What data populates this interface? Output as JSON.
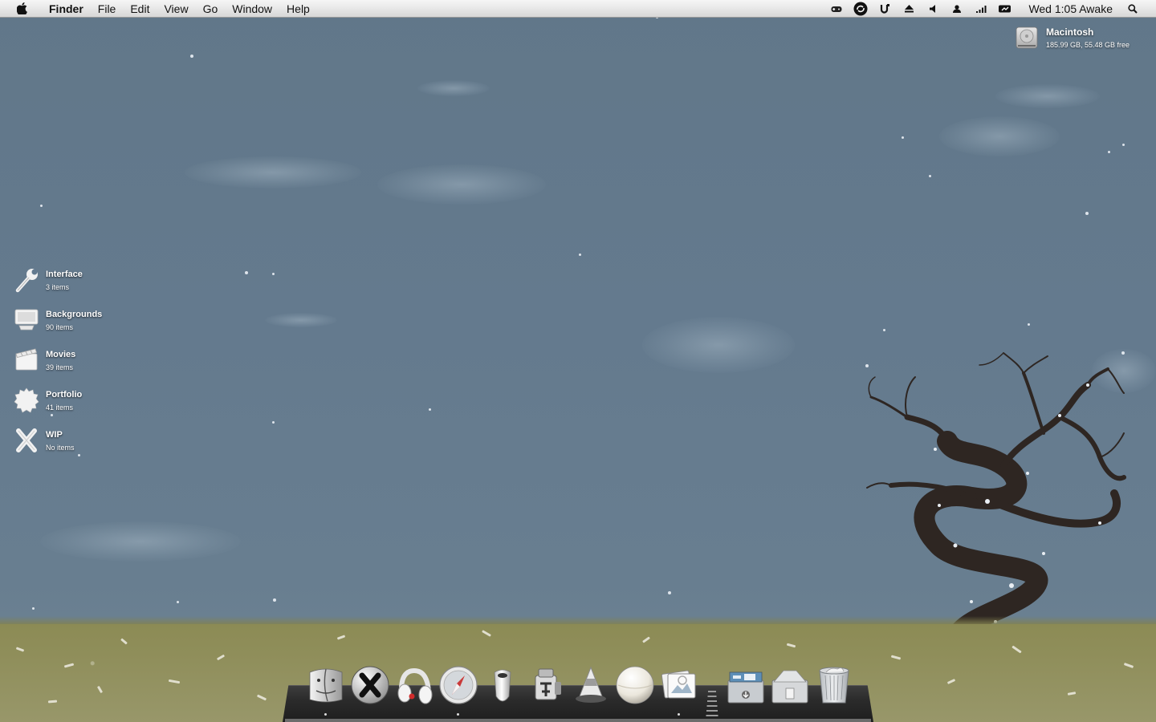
{
  "menubar": {
    "apple_icon": "apple-icon",
    "app_name": "Finder",
    "menus": [
      "File",
      "Edit",
      "View",
      "Go",
      "Window",
      "Help"
    ],
    "status_icons": [
      "gamepad-icon",
      "sync-icon",
      "u-icon",
      "eject-icon",
      "volume-icon",
      "user-icon",
      "wifi-icon",
      "battery-icon"
    ],
    "clock": "Wed 1:05 Awake",
    "search_icon": "spotlight-icon"
  },
  "volume": {
    "name": "Macintosh",
    "info": "185.99 GB, 55.48 GB free"
  },
  "desktop_folders": [
    {
      "name": "Interface",
      "count": "3 items",
      "icon": "wrench-icon"
    },
    {
      "name": "Backgrounds",
      "count": "90 items",
      "icon": "monitor-icon"
    },
    {
      "name": "Movies",
      "count": "39 items",
      "icon": "clapperboard-icon"
    },
    {
      "name": "Portfolio",
      "count": "41 items",
      "icon": "badge-icon"
    },
    {
      "name": "WIP",
      "count": "No items",
      "icon": "x-icon"
    }
  ],
  "dock": {
    "items": [
      {
        "name": "finder",
        "icon": "finder-icon",
        "running": true
      },
      {
        "name": "system-x",
        "icon": "x-app-icon",
        "running": false
      },
      {
        "name": "beats-headphones",
        "icon": "headphones-icon",
        "running": false
      },
      {
        "name": "safari",
        "icon": "compass-icon",
        "running": true
      },
      {
        "name": "capsule",
        "icon": "capsule-icon",
        "running": false
      },
      {
        "name": "automator",
        "icon": "robot-icon",
        "running": false
      },
      {
        "name": "vlc",
        "icon": "traffic-cone-icon",
        "running": false
      },
      {
        "name": "orb",
        "icon": "sphere-icon",
        "running": false
      },
      {
        "name": "preview",
        "icon": "photo-icon",
        "running": true
      },
      {
        "name": "downloads-stack",
        "icon": "downloads-box-icon",
        "running": false
      },
      {
        "name": "documents-stack",
        "icon": "documents-box-icon",
        "running": false
      },
      {
        "name": "trash",
        "icon": "trash-icon",
        "running": false
      }
    ]
  }
}
